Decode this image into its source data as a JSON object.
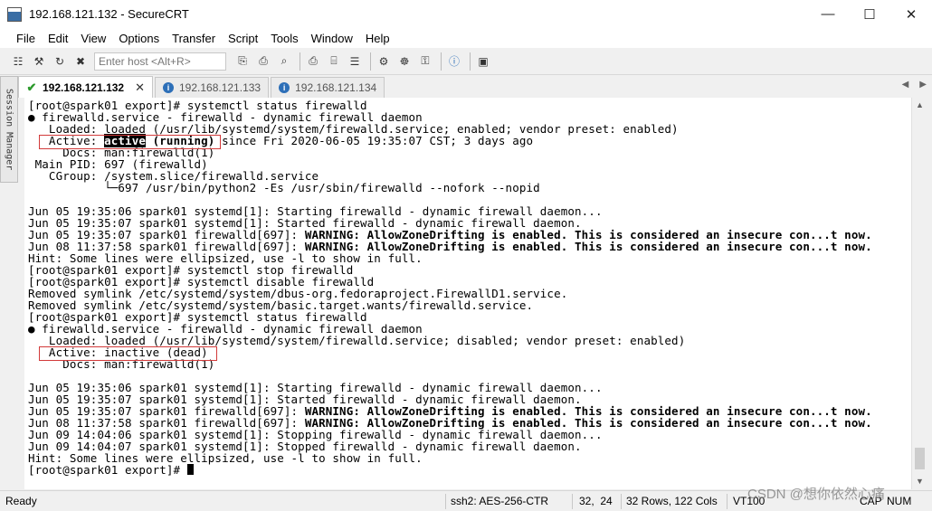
{
  "window": {
    "title": "192.168.121.132 - SecureCRT"
  },
  "menu": [
    "File",
    "Edit",
    "View",
    "Options",
    "Transfer",
    "Script",
    "Tools",
    "Window",
    "Help"
  ],
  "toolbar": {
    "host_placeholder": "Enter host <Alt+R>"
  },
  "session_manager_label": "Session Manager",
  "tabs": [
    {
      "label": "192.168.121.132",
      "active": true
    },
    {
      "label": "192.168.121.133",
      "active": false
    },
    {
      "label": "192.168.121.134",
      "active": false
    }
  ],
  "terminal": {
    "lines": [
      {
        "segments": [
          {
            "text": "[root@spark01 export]# systemctl status firewalld"
          }
        ]
      },
      {
        "segments": [
          {
            "text": "● firewalld.service - firewalld - dynamic firewall daemon"
          }
        ]
      },
      {
        "segments": [
          {
            "text": "   Loaded: loaded (/usr/lib/systemd/system/firewalld.service; enabled; vendor preset: enabled)"
          }
        ]
      },
      {
        "segments": [
          {
            "text": "   Active: "
          },
          {
            "text": "active",
            "style": "hl"
          },
          {
            "text": " (running)",
            "style": "bold"
          },
          {
            "text": " since Fri 2020-06-05 19:35:07 CST; 3 days ago"
          }
        ]
      },
      {
        "segments": [
          {
            "text": "     Docs: man:firewalld(1)"
          }
        ]
      },
      {
        "segments": [
          {
            "text": " Main PID: 697 (firewalld)"
          }
        ]
      },
      {
        "segments": [
          {
            "text": "   CGroup: /system.slice/firewalld.service"
          }
        ]
      },
      {
        "segments": [
          {
            "text": "           └─697 /usr/bin/python2 -Es /usr/sbin/firewalld --nofork --nopid"
          }
        ]
      },
      {
        "segments": [
          {
            "text": ""
          }
        ]
      },
      {
        "segments": [
          {
            "text": "Jun 05 19:35:06 spark01 systemd[1]: Starting firewalld - dynamic firewall daemon..."
          }
        ]
      },
      {
        "segments": [
          {
            "text": "Jun 05 19:35:07 spark01 systemd[1]: Started firewalld - dynamic firewall daemon."
          }
        ]
      },
      {
        "segments": [
          {
            "text": "Jun 05 19:35:07 spark01 firewalld[697]: "
          },
          {
            "text": "WARNING: AllowZoneDrifting is enabled. This is considered an insecure con...t now.",
            "style": "bold"
          }
        ]
      },
      {
        "segments": [
          {
            "text": "Jun 08 11:37:58 spark01 firewalld[697]: "
          },
          {
            "text": "WARNING: AllowZoneDrifting is enabled. This is considered an insecure con...t now.",
            "style": "bold"
          }
        ]
      },
      {
        "segments": [
          {
            "text": "Hint: Some lines were ellipsized, use -l to show in full."
          }
        ]
      },
      {
        "segments": [
          {
            "text": "[root@spark01 export]# systemctl stop firewalld"
          }
        ]
      },
      {
        "segments": [
          {
            "text": "[root@spark01 export]# systemctl disable firewalld"
          }
        ]
      },
      {
        "segments": [
          {
            "text": "Removed symlink /etc/systemd/system/dbus-org.fedoraproject.FirewallD1.service."
          }
        ]
      },
      {
        "segments": [
          {
            "text": "Removed symlink /etc/systemd/system/basic.target.wants/firewalld.service."
          }
        ]
      },
      {
        "segments": [
          {
            "text": "[root@spark01 export]# systemctl status firewalld"
          }
        ]
      },
      {
        "segments": [
          {
            "text": "● firewalld.service - firewalld - dynamic firewall daemon"
          }
        ]
      },
      {
        "segments": [
          {
            "text": "   Loaded: loaded (/usr/lib/systemd/system/firewalld.service; disabled; vendor preset: enabled)"
          }
        ]
      },
      {
        "segments": [
          {
            "text": "   Active: inactive (dead)"
          }
        ]
      },
      {
        "segments": [
          {
            "text": "     Docs: man:firewalld(1)"
          }
        ]
      },
      {
        "segments": [
          {
            "text": ""
          }
        ]
      },
      {
        "segments": [
          {
            "text": "Jun 05 19:35:06 spark01 systemd[1]: Starting firewalld - dynamic firewall daemon..."
          }
        ]
      },
      {
        "segments": [
          {
            "text": "Jun 05 19:35:07 spark01 systemd[1]: Started firewalld - dynamic firewall daemon."
          }
        ]
      },
      {
        "segments": [
          {
            "text": "Jun 05 19:35:07 spark01 firewalld[697]: "
          },
          {
            "text": "WARNING: AllowZoneDrifting is enabled. This is considered an insecure con...t now.",
            "style": "bold"
          }
        ]
      },
      {
        "segments": [
          {
            "text": "Jun 08 11:37:58 spark01 firewalld[697]: "
          },
          {
            "text": "WARNING: AllowZoneDrifting is enabled. This is considered an insecure con...t now.",
            "style": "bold"
          }
        ]
      },
      {
        "segments": [
          {
            "text": "Jun 09 14:04:06 spark01 systemd[1]: Stopping firewalld - dynamic firewall daemon..."
          }
        ]
      },
      {
        "segments": [
          {
            "text": "Jun 09 14:04:07 spark01 systemd[1]: Stopped firewalld - dynamic firewall daemon."
          }
        ]
      },
      {
        "segments": [
          {
            "text": "Hint: Some lines were ellipsized, use -l to show in full."
          }
        ]
      },
      {
        "segments": [
          {
            "text": "[root@spark01 export]# "
          }
        ],
        "cursor": true
      }
    ]
  },
  "status": {
    "ready": "Ready",
    "protocol": "ssh2: AES-256-CTR",
    "position": "32,  24",
    "size": "32 Rows, 122 Cols",
    "terminal_type": "VT100",
    "caps": "CAP",
    "num": "NUM"
  },
  "watermark": "CSDN @想你依然心痛",
  "colors": {
    "annotation_box": "#d23a3a"
  }
}
